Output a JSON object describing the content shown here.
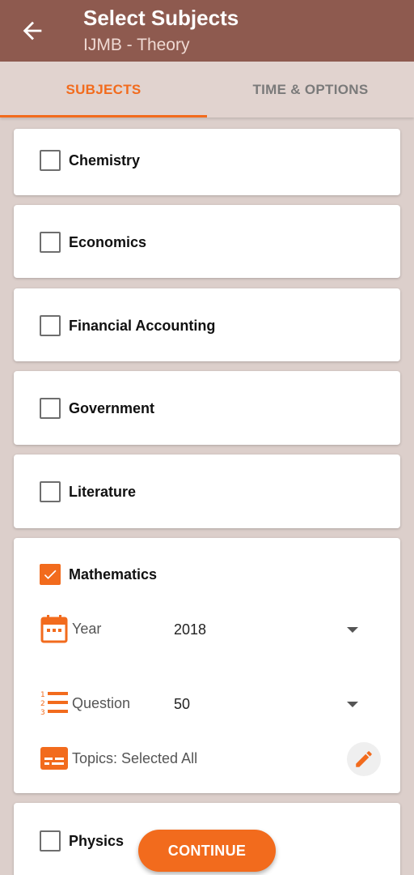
{
  "header": {
    "title": "Select Subjects",
    "subtitle": "IJMB - Theory"
  },
  "tabs": [
    {
      "label": "SUBJECTS",
      "active": true
    },
    {
      "label": "TIME & OPTIONS",
      "active": false
    }
  ],
  "subjects": [
    {
      "label": "Chemistry",
      "checked": false
    },
    {
      "label": "Economics",
      "checked": false
    },
    {
      "label": "Financial Accounting",
      "checked": false
    },
    {
      "label": "Government",
      "checked": false
    },
    {
      "label": "Literature",
      "checked": false
    },
    {
      "label": "Mathematics",
      "checked": true
    },
    {
      "label": "Physics",
      "checked": false
    }
  ],
  "mathematics_options": {
    "year_label": "Year",
    "year_value": "2018",
    "question_label": "Question",
    "question_value": "50",
    "topics_text": "Topics: Selected All"
  },
  "continue_label": "CONTINUE",
  "colors": {
    "accent": "#f26b1d",
    "appbar": "#8e5a4f",
    "background": "#dccfcb"
  }
}
